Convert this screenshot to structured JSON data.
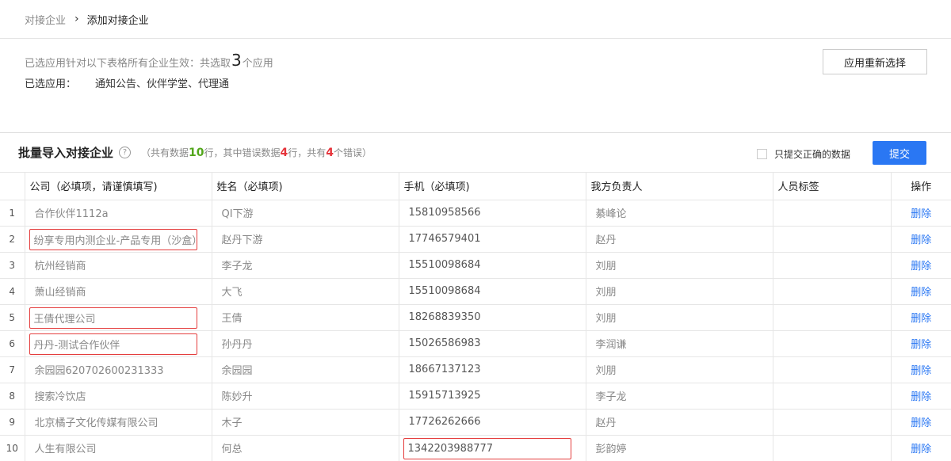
{
  "breadcrumb": {
    "parent": "对接企业",
    "current": "添加对接企业"
  },
  "info": {
    "prefix": "已选应用针对以下表格所有企业生效：共选取",
    "count": "3",
    "suffix": "个应用",
    "apps_label": "已选应用：",
    "apps_value": "通知公告、伙伴学堂、代理通"
  },
  "reselect_button": "应用重新选择",
  "panel": {
    "title": "批量导入对接企业",
    "stats_a": "（共有数据",
    "total": "10",
    "stats_b": "行，其中错误数据",
    "error_rows": "4",
    "stats_c": "行，共有",
    "error_count": "4",
    "stats_d": "个错误）",
    "only_correct_label": "只提交正确的数据",
    "submit_label": "提交"
  },
  "table": {
    "headers": {
      "company": "公司（必填项，请谨慎填写)",
      "name": "姓名（必填项)",
      "phone": "手机（必填项)",
      "owner": "我方负责人",
      "tag": "人员标签",
      "action": "操作"
    },
    "delete_label": "删除",
    "rows": [
      {
        "idx": "1",
        "company": "合作伙伴1112a",
        "name": "QI下游",
        "phone": "15810958566",
        "owner": "綦峰论",
        "tag": ""
      },
      {
        "idx": "2",
        "company": "纷享专用内测企业-产品专用（沙盒）",
        "name": "赵丹下游",
        "phone": "17746579401",
        "owner": "赵丹",
        "tag": ""
      },
      {
        "idx": "3",
        "company": "杭州经销商",
        "name": "李子龙",
        "phone": "15510098684",
        "owner": "刘朋",
        "tag": ""
      },
      {
        "idx": "4",
        "company": "萧山经销商",
        "name": "大飞",
        "phone": "15510098684",
        "owner": "刘朋",
        "tag": ""
      },
      {
        "idx": "5",
        "company": "王倩代理公司",
        "name": "王倩",
        "phone": "18268839350",
        "owner": "刘朋",
        "tag": ""
      },
      {
        "idx": "6",
        "company": "丹丹-测试合作伙伴",
        "name": "孙丹丹",
        "phone": "15026586983",
        "owner": "李润谦",
        "tag": ""
      },
      {
        "idx": "7",
        "company": "余园园620702600231333",
        "name": "余园园",
        "phone": "18667137123",
        "owner": "刘朋",
        "tag": ""
      },
      {
        "idx": "8",
        "company": "搜索冷饮店",
        "name": "陈妙升",
        "phone": "15915713925",
        "owner": "李子龙",
        "tag": ""
      },
      {
        "idx": "9",
        "company": "北京橘子文化传媒有限公司",
        "name": "木子",
        "phone": "17726262666",
        "owner": "赵丹",
        "tag": ""
      },
      {
        "idx": "10",
        "company": "人生有限公司",
        "name": "何总",
        "phone": "1342203988777",
        "owner": "彭韵婷",
        "tag": ""
      }
    ]
  }
}
